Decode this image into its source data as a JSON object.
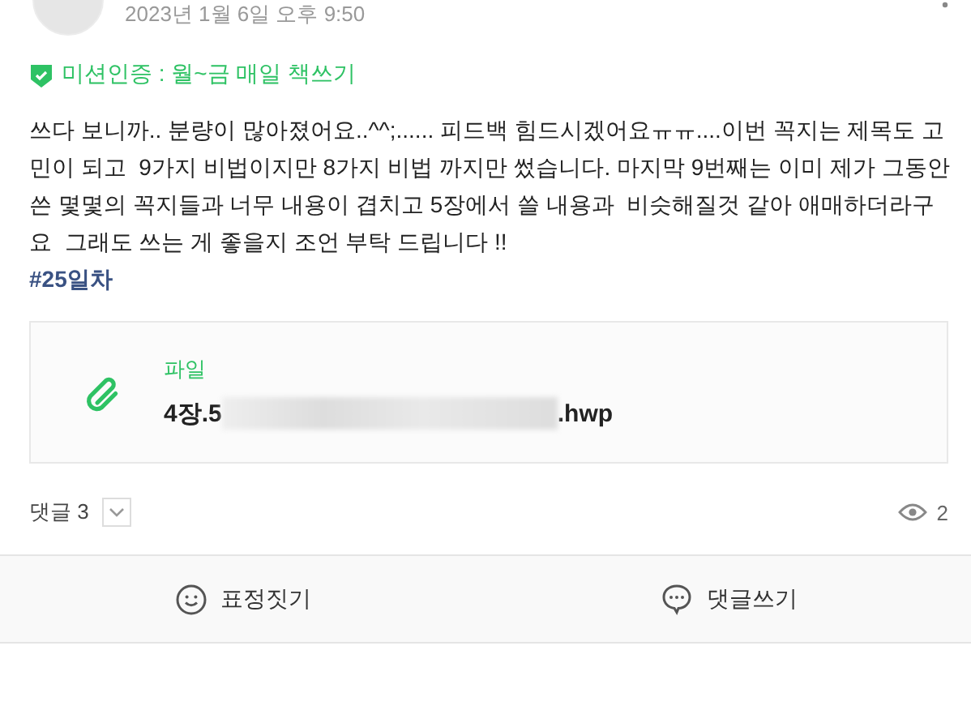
{
  "post": {
    "date": "2023년 1월 6일 오후 9:50",
    "mission": "미션인증 : 월~금 매일 책쓰기",
    "body": "쓰다 보니까.. 분량이 많아졌어요..^^;...... 피드백 힘드시겠어요ㅠㅠ....이번 꼭지는 제목도 고민이 되고  9가지 비법이지만 8가지 비법 까지만 썼습니다. 마지막 9번째는 이미 제가 그동안 쓴 몇몇의 꼭지들과 너무 내용이 겹치고 5장에서 쓸 내용과  비슷해질것 같아 애매하더라구요  그래도 쓰는 게 좋을지 조언 부탁 드립니다 !!",
    "hashtag": "#25일차"
  },
  "attachment": {
    "label": "파일",
    "name_start": "4장.5",
    "name_end": ".hwp",
    "redacted": true
  },
  "footer": {
    "comments": "댓글 3",
    "expanded": false,
    "views": "2"
  },
  "actions": [
    {
      "kind": "emotion",
      "label": "표정짓기"
    },
    {
      "kind": "comment",
      "label": "댓글쓰기"
    }
  ]
}
